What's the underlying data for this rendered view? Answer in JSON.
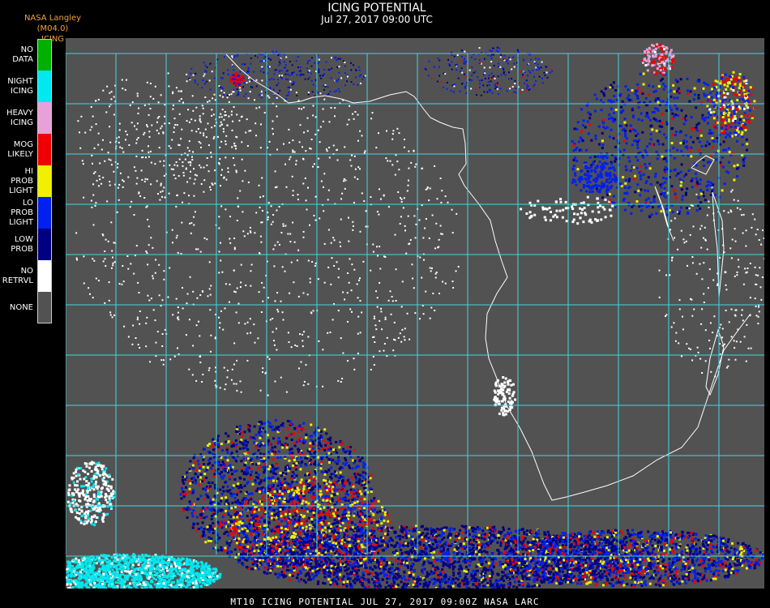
{
  "header": {
    "source": "NASA Langley (M04.0)",
    "product_short": "ICING",
    "title": "ICING POTENTIAL",
    "subtitle": "Jul 27, 2017 09:00 UTC"
  },
  "legend": [
    {
      "label": "NO DATA",
      "color": "#00b000"
    },
    {
      "label": "NIGHT\nICING",
      "color": "#00e8f0"
    },
    {
      "label": "HEAVY\nICING",
      "color": "#e8a0d8"
    },
    {
      "label": "MOG\nLIKELY",
      "color": "#f00000"
    },
    {
      "label": "HI PROB\nLIGHT",
      "color": "#f0f000"
    },
    {
      "label": "LO PROB\nLIGHT",
      "color": "#0020f0"
    },
    {
      "label": "LOW\nPROB",
      "color": "#000080"
    },
    {
      "label": "NO\nRETRVL",
      "color": "#ffffff"
    },
    {
      "label": "NONE",
      "color": "#525252"
    }
  ],
  "map": {
    "background_color": "#525252",
    "grid_color": "#40d8e0",
    "coastline_color": "#ffffff",
    "grid_label_color": "#c01818"
  },
  "footer": {
    "text": "MT10  ICING POTENTIAL   JUL 27, 2017 09:00Z   NASA LARC"
  }
}
